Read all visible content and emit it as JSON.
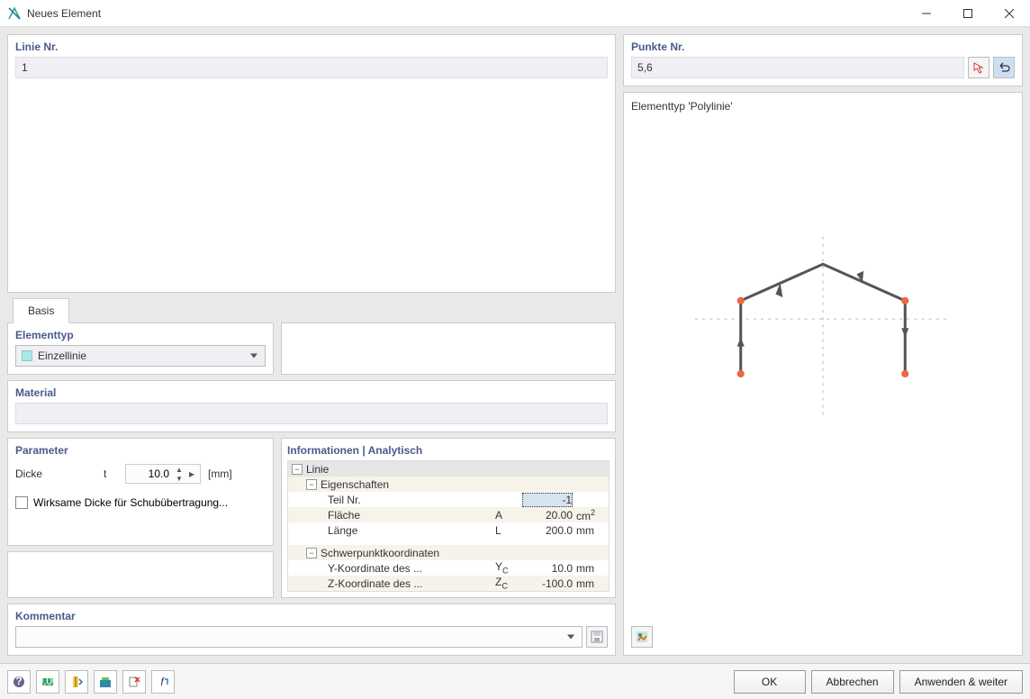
{
  "window": {
    "title": "Neues Element"
  },
  "line_panel": {
    "label": "Linie Nr.",
    "value": "1"
  },
  "punkte_panel": {
    "label": "Punkte Nr.",
    "value": "5,6"
  },
  "tabs": {
    "basis": "Basis"
  },
  "elementtype": {
    "label": "Elementtyp",
    "selected": "Einzellinie"
  },
  "material": {
    "label": "Material",
    "value": ""
  },
  "parameter": {
    "label": "Parameter",
    "dicke_label": "Dicke",
    "dicke_sym": "t",
    "dicke_value": "10.0",
    "dicke_unit": "[mm]",
    "wirksame": "Wirksame Dicke für Schubübertragung..."
  },
  "info": {
    "header": "Informationen | Analytisch",
    "linie": "Linie",
    "eigenschaften": "Eigenschaften",
    "teilnr": {
      "label": "Teil Nr.",
      "value": "-1"
    },
    "flaeche": {
      "label": "Fläche",
      "sym": "A",
      "value": "20.00",
      "unit": "cm²"
    },
    "laenge": {
      "label": "Länge",
      "sym": "L",
      "value": "200.0",
      "unit": "mm"
    },
    "schwerpunkt": "Schwerpunktkoordinaten",
    "yc": {
      "label": "Y-Koordinate des ...",
      "sym": "Yc",
      "value": "10.0",
      "unit": "mm"
    },
    "zc": {
      "label": "Z-Koordinate des ...",
      "sym": "Zc",
      "value": "-100.0",
      "unit": "mm"
    }
  },
  "kommentar": {
    "label": "Kommentar"
  },
  "preview": {
    "label": "Elementtyp 'Polylinie'"
  },
  "footer": {
    "ok": "OK",
    "cancel": "Abbrechen",
    "apply": "Anwenden & weiter"
  }
}
